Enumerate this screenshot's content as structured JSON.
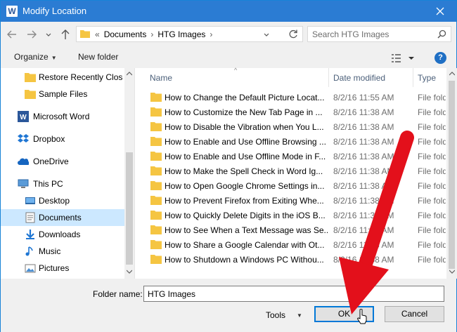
{
  "window": {
    "title": "Modify Location",
    "app_icon_letter": "W"
  },
  "address": {
    "crumbs": [
      "«",
      "Documents",
      "›",
      "HTG Images",
      "›"
    ],
    "search_placeholder": "Search HTG Images"
  },
  "toolbar": {
    "organize_label": "Organize",
    "new_folder_label": "New folder",
    "help_label": "?"
  },
  "sidebar": {
    "items": [
      {
        "label": "Restore Recently Close",
        "icon": "folder-icon"
      },
      {
        "label": "Sample Files",
        "icon": "folder-icon"
      },
      {
        "label": "Microsoft Word",
        "icon": "word-icon"
      },
      {
        "label": "Dropbox",
        "icon": "dropbox-icon"
      },
      {
        "label": "OneDrive",
        "icon": "onedrive-icon"
      },
      {
        "label": "This PC",
        "icon": "computer-icon"
      },
      {
        "label": "Desktop",
        "icon": "desktop-icon"
      },
      {
        "label": "Documents",
        "icon": "documents-icon",
        "selected": true
      },
      {
        "label": "Downloads",
        "icon": "downloads-icon"
      },
      {
        "label": "Music",
        "icon": "music-icon"
      },
      {
        "label": "Pictures",
        "icon": "pictures-icon"
      }
    ]
  },
  "files": {
    "columns": {
      "name": "Name",
      "date": "Date modified",
      "type": "Type"
    },
    "rows": [
      {
        "name": "How to Change the Default Picture Locat...",
        "date": "8/2/16 11:55 AM",
        "type": "File folder"
      },
      {
        "name": "How to Customize the New Tab Page in ...",
        "date": "8/2/16 11:38 AM",
        "type": "File folder"
      },
      {
        "name": "How to Disable the Vibration when You L...",
        "date": "8/2/16 11:38 AM",
        "type": "File folder"
      },
      {
        "name": "How to Enable and Use Offline Browsing ...",
        "date": "8/2/16 11:38 AM",
        "type": "File folder"
      },
      {
        "name": "How to Enable and Use Offline Mode in F...",
        "date": "8/2/16 11:38 AM",
        "type": "File folder"
      },
      {
        "name": "How to Make the Spell Check in Word Ig...",
        "date": "8/2/16 11:38 AM",
        "type": "File folder"
      },
      {
        "name": "How to Open Google Chrome Settings in...",
        "date": "8/2/16 11:38 AM",
        "type": "File folder"
      },
      {
        "name": "How to Prevent Firefox from Exiting Whe...",
        "date": "8/2/16 11:38 AM",
        "type": "File folder"
      },
      {
        "name": "How to Quickly Delete Digits in the iOS B...",
        "date": "8/2/16 11:38 AM",
        "type": "File folder"
      },
      {
        "name": "How to See When a Text Message was Se...",
        "date": "8/2/16 11:38 AM",
        "type": "File folder"
      },
      {
        "name": "How to Share a Google Calendar with Ot...",
        "date": "8/2/16 11:38 AM",
        "type": "File folder"
      },
      {
        "name": "How to Shutdown a Windows PC Withou...",
        "date": "8/2/16 11:38 AM",
        "type": "File folder"
      }
    ]
  },
  "footer": {
    "folder_name_label": "Folder name:",
    "folder_name_value": "HTG Images",
    "tools_label": "Tools",
    "ok_label": "OK",
    "cancel_label": "Cancel"
  },
  "colors": {
    "titlebar": "#2b7cd3",
    "selection": "#cce8ff",
    "folder": "#f5c542",
    "annotation_arrow": "#e3101b",
    "ok_border": "#0078d7"
  }
}
